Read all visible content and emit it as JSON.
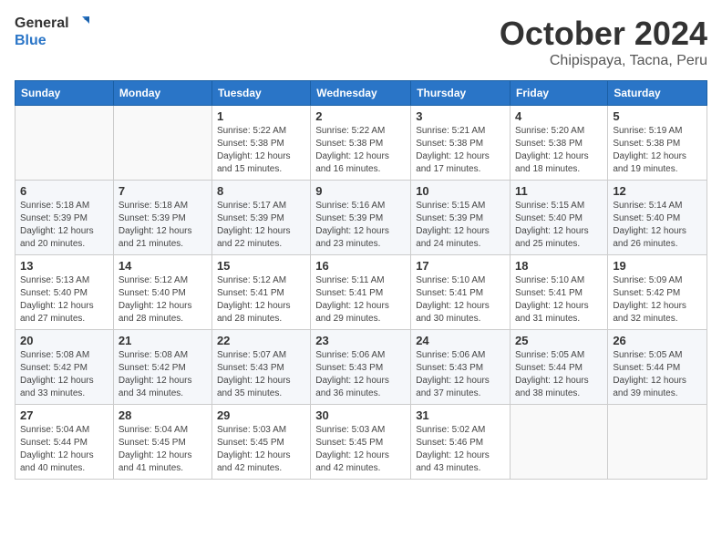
{
  "logo": {
    "line1": "General",
    "line2": "Blue"
  },
  "title": "October 2024",
  "subtitle": "Chipispaya, Tacna, Peru",
  "weekdays": [
    "Sunday",
    "Monday",
    "Tuesday",
    "Wednesday",
    "Thursday",
    "Friday",
    "Saturday"
  ],
  "weeks": [
    [
      {
        "day": "",
        "sunrise": "",
        "sunset": "",
        "daylight": ""
      },
      {
        "day": "",
        "sunrise": "",
        "sunset": "",
        "daylight": ""
      },
      {
        "day": "1",
        "sunrise": "Sunrise: 5:22 AM",
        "sunset": "Sunset: 5:38 PM",
        "daylight": "Daylight: 12 hours and 15 minutes."
      },
      {
        "day": "2",
        "sunrise": "Sunrise: 5:22 AM",
        "sunset": "Sunset: 5:38 PM",
        "daylight": "Daylight: 12 hours and 16 minutes."
      },
      {
        "day": "3",
        "sunrise": "Sunrise: 5:21 AM",
        "sunset": "Sunset: 5:38 PM",
        "daylight": "Daylight: 12 hours and 17 minutes."
      },
      {
        "day": "4",
        "sunrise": "Sunrise: 5:20 AM",
        "sunset": "Sunset: 5:38 PM",
        "daylight": "Daylight: 12 hours and 18 minutes."
      },
      {
        "day": "5",
        "sunrise": "Sunrise: 5:19 AM",
        "sunset": "Sunset: 5:38 PM",
        "daylight": "Daylight: 12 hours and 19 minutes."
      }
    ],
    [
      {
        "day": "6",
        "sunrise": "Sunrise: 5:18 AM",
        "sunset": "Sunset: 5:39 PM",
        "daylight": "Daylight: 12 hours and 20 minutes."
      },
      {
        "day": "7",
        "sunrise": "Sunrise: 5:18 AM",
        "sunset": "Sunset: 5:39 PM",
        "daylight": "Daylight: 12 hours and 21 minutes."
      },
      {
        "day": "8",
        "sunrise": "Sunrise: 5:17 AM",
        "sunset": "Sunset: 5:39 PM",
        "daylight": "Daylight: 12 hours and 22 minutes."
      },
      {
        "day": "9",
        "sunrise": "Sunrise: 5:16 AM",
        "sunset": "Sunset: 5:39 PM",
        "daylight": "Daylight: 12 hours and 23 minutes."
      },
      {
        "day": "10",
        "sunrise": "Sunrise: 5:15 AM",
        "sunset": "Sunset: 5:39 PM",
        "daylight": "Daylight: 12 hours and 24 minutes."
      },
      {
        "day": "11",
        "sunrise": "Sunrise: 5:15 AM",
        "sunset": "Sunset: 5:40 PM",
        "daylight": "Daylight: 12 hours and 25 minutes."
      },
      {
        "day": "12",
        "sunrise": "Sunrise: 5:14 AM",
        "sunset": "Sunset: 5:40 PM",
        "daylight": "Daylight: 12 hours and 26 minutes."
      }
    ],
    [
      {
        "day": "13",
        "sunrise": "Sunrise: 5:13 AM",
        "sunset": "Sunset: 5:40 PM",
        "daylight": "Daylight: 12 hours and 27 minutes."
      },
      {
        "day": "14",
        "sunrise": "Sunrise: 5:12 AM",
        "sunset": "Sunset: 5:40 PM",
        "daylight": "Daylight: 12 hours and 28 minutes."
      },
      {
        "day": "15",
        "sunrise": "Sunrise: 5:12 AM",
        "sunset": "Sunset: 5:41 PM",
        "daylight": "Daylight: 12 hours and 28 minutes."
      },
      {
        "day": "16",
        "sunrise": "Sunrise: 5:11 AM",
        "sunset": "Sunset: 5:41 PM",
        "daylight": "Daylight: 12 hours and 29 minutes."
      },
      {
        "day": "17",
        "sunrise": "Sunrise: 5:10 AM",
        "sunset": "Sunset: 5:41 PM",
        "daylight": "Daylight: 12 hours and 30 minutes."
      },
      {
        "day": "18",
        "sunrise": "Sunrise: 5:10 AM",
        "sunset": "Sunset: 5:41 PM",
        "daylight": "Daylight: 12 hours and 31 minutes."
      },
      {
        "day": "19",
        "sunrise": "Sunrise: 5:09 AM",
        "sunset": "Sunset: 5:42 PM",
        "daylight": "Daylight: 12 hours and 32 minutes."
      }
    ],
    [
      {
        "day": "20",
        "sunrise": "Sunrise: 5:08 AM",
        "sunset": "Sunset: 5:42 PM",
        "daylight": "Daylight: 12 hours and 33 minutes."
      },
      {
        "day": "21",
        "sunrise": "Sunrise: 5:08 AM",
        "sunset": "Sunset: 5:42 PM",
        "daylight": "Daylight: 12 hours and 34 minutes."
      },
      {
        "day": "22",
        "sunrise": "Sunrise: 5:07 AM",
        "sunset": "Sunset: 5:43 PM",
        "daylight": "Daylight: 12 hours and 35 minutes."
      },
      {
        "day": "23",
        "sunrise": "Sunrise: 5:06 AM",
        "sunset": "Sunset: 5:43 PM",
        "daylight": "Daylight: 12 hours and 36 minutes."
      },
      {
        "day": "24",
        "sunrise": "Sunrise: 5:06 AM",
        "sunset": "Sunset: 5:43 PM",
        "daylight": "Daylight: 12 hours and 37 minutes."
      },
      {
        "day": "25",
        "sunrise": "Sunrise: 5:05 AM",
        "sunset": "Sunset: 5:44 PM",
        "daylight": "Daylight: 12 hours and 38 minutes."
      },
      {
        "day": "26",
        "sunrise": "Sunrise: 5:05 AM",
        "sunset": "Sunset: 5:44 PM",
        "daylight": "Daylight: 12 hours and 39 minutes."
      }
    ],
    [
      {
        "day": "27",
        "sunrise": "Sunrise: 5:04 AM",
        "sunset": "Sunset: 5:44 PM",
        "daylight": "Daylight: 12 hours and 40 minutes."
      },
      {
        "day": "28",
        "sunrise": "Sunrise: 5:04 AM",
        "sunset": "Sunset: 5:45 PM",
        "daylight": "Daylight: 12 hours and 41 minutes."
      },
      {
        "day": "29",
        "sunrise": "Sunrise: 5:03 AM",
        "sunset": "Sunset: 5:45 PM",
        "daylight": "Daylight: 12 hours and 42 minutes."
      },
      {
        "day": "30",
        "sunrise": "Sunrise: 5:03 AM",
        "sunset": "Sunset: 5:45 PM",
        "daylight": "Daylight: 12 hours and 42 minutes."
      },
      {
        "day": "31",
        "sunrise": "Sunrise: 5:02 AM",
        "sunset": "Sunset: 5:46 PM",
        "daylight": "Daylight: 12 hours and 43 minutes."
      },
      {
        "day": "",
        "sunrise": "",
        "sunset": "",
        "daylight": ""
      },
      {
        "day": "",
        "sunrise": "",
        "sunset": "",
        "daylight": ""
      }
    ]
  ]
}
